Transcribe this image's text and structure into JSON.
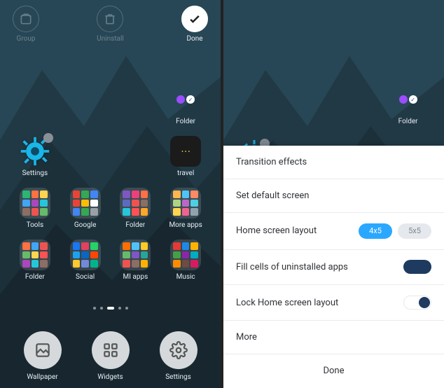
{
  "left": {
    "top": {
      "group": {
        "label": "Group",
        "enabled": false
      },
      "uninstall": {
        "label": "Uninstall",
        "enabled": false
      },
      "done": {
        "label": "Done",
        "enabled": true
      }
    },
    "apps": {
      "folder_top": {
        "label": "Folder"
      },
      "settings": {
        "label": "Settings"
      },
      "travel": {
        "label": "travel"
      },
      "tools": {
        "label": "Tools"
      },
      "google": {
        "label": "Google"
      },
      "folder_games": {
        "label": "Folder"
      },
      "more_apps": {
        "label": "More apps"
      },
      "folder_misc": {
        "label": "Folder"
      },
      "social": {
        "label": "Social"
      },
      "mi_apps": {
        "label": "MI apps"
      },
      "music": {
        "label": "Music"
      }
    },
    "pager": {
      "total": 5,
      "active_index": 2
    },
    "dock": {
      "wallpaper": {
        "label": "Wallpaper"
      },
      "widgets": {
        "label": "Widgets"
      },
      "settings": {
        "label": "Settings"
      }
    }
  },
  "right": {
    "folder_top": {
      "label": "Folder"
    },
    "sheet": {
      "transition": {
        "label": "Transition effects"
      },
      "default": {
        "label": "Set default screen"
      },
      "layout": {
        "label": "Home screen layout",
        "options": [
          "4x5",
          "5x5"
        ],
        "selected": "4x5"
      },
      "fill": {
        "label": "Fill cells of uninstalled apps",
        "on": true
      },
      "lock": {
        "label": "Lock Home screen layout",
        "on": false
      },
      "more": {
        "label": "More"
      },
      "done": {
        "label": "Done"
      }
    }
  },
  "folder_colors": {
    "tools": [
      "#2bb673",
      "#ff7043",
      "#ffd54f",
      "#42a5f5",
      "#ab47bc",
      "#26c6da",
      "#8d6e63",
      "#ef5350",
      "#66bb6a"
    ],
    "google": [
      "#ea4335",
      "#34a853",
      "#4285f4",
      "#ea4335",
      "#fbbc05",
      "#ffffff",
      "#4285f4",
      "#34a853",
      "#9aa0a6"
    ],
    "games": [
      "#7e57c2",
      "#ec407a",
      "#ff7043",
      "#5c6bc0",
      "#ef5350",
      "#8d6e63",
      "#26c6da",
      "#ff5252",
      "#ffa726"
    ],
    "more": [
      "#ffb74d",
      "#4fc3f7",
      "#ff8a65",
      "#aed581",
      "#ba68c8",
      "#4dd0e1",
      "#ffd54f",
      "#f06292",
      "#90a4ae"
    ],
    "misc": [
      "#ff7043",
      "#42a5f5",
      "#ef5350",
      "#66bb6a",
      "#ffd54f",
      "#ff5252",
      "#ab47bc",
      "#26c6da",
      "#8d6e63"
    ],
    "social": [
      "#1877f2",
      "#e4405f",
      "#25d366",
      "#1da1f2",
      "#0a66c2",
      "#ff4500",
      "#ffcb2b",
      "#7289da",
      "#00b489"
    ],
    "mi": [
      "#ff6f00",
      "#4fc3f7",
      "#ffca28",
      "#66bb6a",
      "#7e57c2",
      "#26a69a",
      "#ef5350",
      "#8d6e63",
      "#ffb300"
    ],
    "music": [
      "#e53935",
      "#1e88e5",
      "#ffb300",
      "#43a047",
      "#8e24aa",
      "#00acc1",
      "#fb8c00",
      "#6d4c41",
      "#d81b60"
    ]
  }
}
